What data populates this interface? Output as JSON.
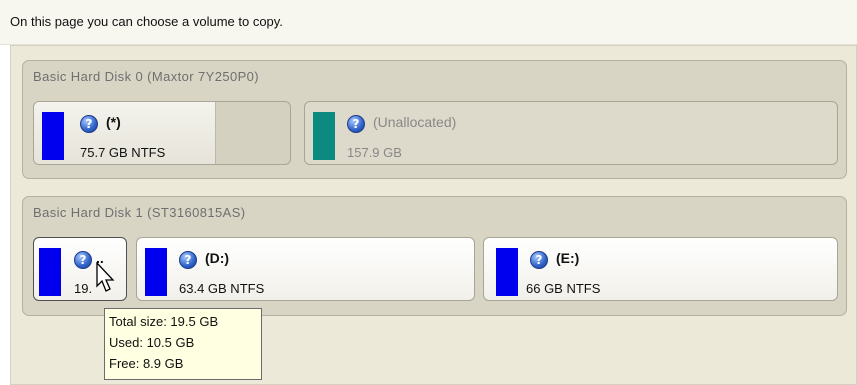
{
  "instruction": "On this page you can choose a volume to copy.",
  "disks": [
    {
      "title": "Basic Hard Disk 0 (Maxtor 7Y250P0)",
      "volumes": [
        {
          "name": "(*)",
          "size": "75.7 GB NTFS",
          "color": "#0000ee"
        },
        {
          "name": "(Unallocated)",
          "size": "157.9 GB",
          "color": "#0d8a80"
        }
      ]
    },
    {
      "title": "Basic Hard Disk 1 (ST3160815AS)",
      "volumes": [
        {
          "name": "..",
          "size": "19.",
          "color": "#0000ee"
        },
        {
          "name": "(D:)",
          "size": "63.4 GB NTFS",
          "color": "#0000ee"
        },
        {
          "name": "(E:)",
          "size": "66 GB NTFS",
          "color": "#0000ee"
        }
      ]
    }
  ],
  "tooltip": {
    "total": "Total size: 19.5 GB",
    "used": "Used: 10.5 GB",
    "free": "Free: 8.9 GB"
  },
  "icons": {
    "info": "question-icon",
    "cursor": "arrow-cursor-icon"
  }
}
